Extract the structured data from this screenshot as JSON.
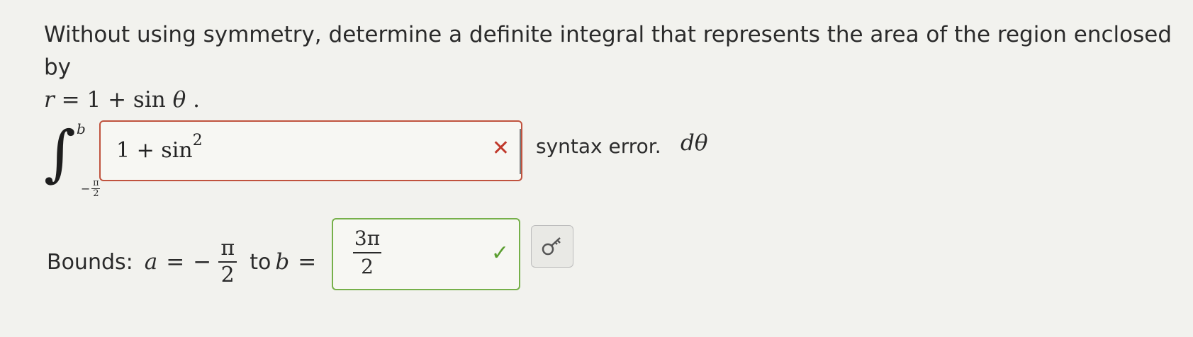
{
  "question": {
    "text": "Without using symmetry, determine a definite integral that represents the area of the region enclosed by",
    "equation_r": "r",
    "equation_rest": " = 1 + sin ",
    "equation_theta": "θ",
    "equation_end": " ."
  },
  "integral": {
    "sign": "∫",
    "upper_bound": "b",
    "lower_minus": "−",
    "lower_num": "π",
    "lower_den": "2"
  },
  "integrand_input": {
    "value": "1 + sin",
    "superscript": "2",
    "status_icon": "x-mark",
    "status_symbol": "✕"
  },
  "feedback": {
    "error_text": "syntax error.",
    "differential": "dθ"
  },
  "bounds": {
    "label": "Bounds:",
    "a_var": "a",
    "equals": "=",
    "minus": "−",
    "a_num": "π",
    "a_den": "2",
    "to_text": "to",
    "b_var": "b",
    "b_equals": "="
  },
  "upper_input": {
    "num": "3π",
    "den": "2",
    "status_icon": "check-mark",
    "status_symbol": "✓"
  },
  "key_button": {
    "icon": "key-icon"
  },
  "colors": {
    "error": "#c0533e",
    "success": "#76b04a",
    "background": "#f2f2ee"
  }
}
